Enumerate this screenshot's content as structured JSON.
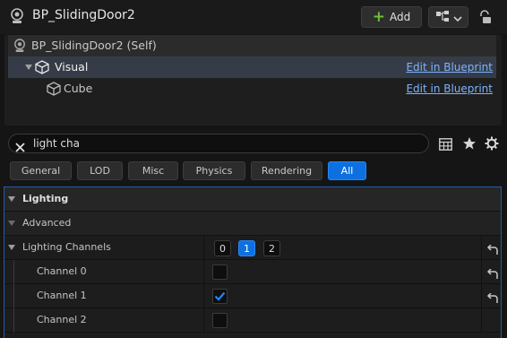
{
  "header": {
    "title": "BP_SlidingDoor2",
    "add_label": "Add",
    "actor_icon": "actor-icon",
    "hierarchy_icon": "hierarchy-icon",
    "lock_icon": "lock-icon"
  },
  "tree": {
    "rows": [
      {
        "label": "BP_SlidingDoor2 (Self)",
        "icon": "actor-icon",
        "link": ""
      },
      {
        "label": "Visual",
        "icon": "cube-icon",
        "link": "Edit in Blueprint"
      },
      {
        "label": "Cube",
        "icon": "cube-icon",
        "link": "Edit in Blueprint"
      }
    ]
  },
  "search": {
    "value": "light cha"
  },
  "filters": {
    "tabs": [
      "General",
      "LOD",
      "Misc",
      "Physics",
      "Rendering",
      "All"
    ],
    "active": "All"
  },
  "properties": {
    "category": "Lighting",
    "advanced_label": "Advanced",
    "lighting_channels": {
      "label": "Lighting Channels",
      "buttons": [
        "0",
        "1",
        "2"
      ],
      "active_button": "1"
    },
    "channels": [
      {
        "label": "Channel 0",
        "checked": false,
        "has_reset": true
      },
      {
        "label": "Channel 1",
        "checked": true,
        "has_reset": true
      },
      {
        "label": "Channel 2",
        "checked": false,
        "has_reset": false
      }
    ]
  },
  "colors": {
    "accent": "#0d70e0",
    "link": "#7db4ff",
    "add_plus": "#6bbf35",
    "selected_row": "#363c47"
  }
}
